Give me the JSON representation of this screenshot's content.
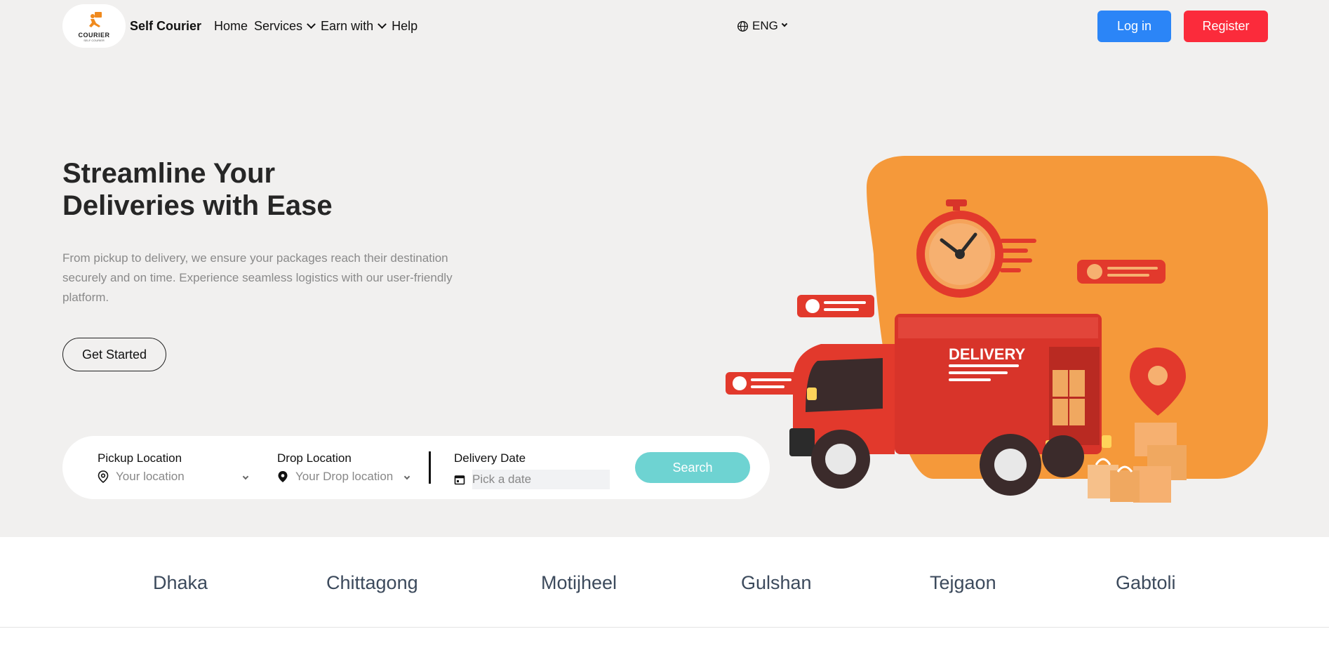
{
  "header": {
    "logo_text": "COURIER",
    "logo_subtext": "SELF COURIER",
    "brand": "Self Courier",
    "nav": [
      {
        "label": "Home",
        "has_dropdown": false
      },
      {
        "label": "Services",
        "has_dropdown": true
      },
      {
        "label": "Earn with",
        "has_dropdown": true
      },
      {
        "label": "Help",
        "has_dropdown": false
      }
    ],
    "language": "ENG",
    "login_label": "Log in",
    "register_label": "Register"
  },
  "hero": {
    "title_line1": "Streamline Your",
    "title_line2": "Deliveries with Ease",
    "description": "From pickup to delivery, we ensure your packages reach their destination securely and on time. Experience seamless logistics with our user-friendly platform.",
    "cta_label": "Get Started",
    "illustration_text": "DELIVERY"
  },
  "search": {
    "pickup_label": "Pickup Location",
    "pickup_placeholder": "Your location",
    "drop_label": "Drop Location",
    "drop_placeholder": "Your Drop location",
    "date_label": "Delivery Date",
    "date_placeholder": "Pick a date",
    "search_label": "Search"
  },
  "locations": [
    "Dhaka",
    "Chittagong",
    "Motijheel",
    "Gulshan",
    "Tejgaon",
    "Gabtoli"
  ],
  "colors": {
    "page_bg": "#f1f0ef",
    "login": "#2b85f7",
    "register": "#fb2b3b",
    "search_button": "#6ed3d2",
    "illustration_orange": "#f5993a",
    "truck_red": "#e2392c"
  },
  "icons": {
    "language": "globe-icon",
    "pickup": "map-pin-outline-icon",
    "drop": "map-pin-filled-icon",
    "date": "calendar-icon"
  }
}
